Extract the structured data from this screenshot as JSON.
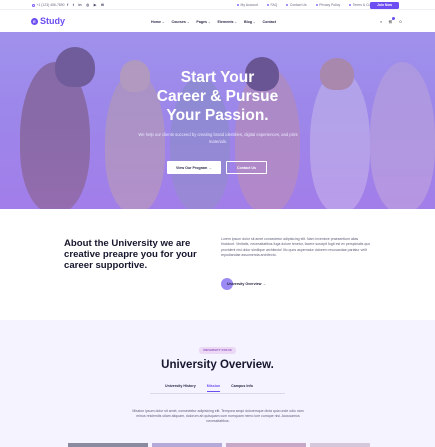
{
  "topbar": {
    "phone": "+1 (123) 456-7890",
    "socials": [
      "f",
      "t",
      "in",
      "◎",
      "▶",
      "✉"
    ],
    "links": [
      "My Account",
      "FAQ",
      "Contact Us",
      "Privacy Policy",
      "Terms & Condition"
    ],
    "join_label": "Join Now"
  },
  "header": {
    "logo_mark": "E",
    "logo_text": "Study",
    "nav": [
      {
        "label": "Home",
        "caret": true
      },
      {
        "label": "Courses",
        "caret": true
      },
      {
        "label": "Pages",
        "caret": true
      },
      {
        "label": "Elements",
        "caret": true
      },
      {
        "label": "Blog",
        "caret": true
      },
      {
        "label": "Contact",
        "caret": false
      }
    ],
    "cart_count": "0",
    "search_icon": "search-icon",
    "cart_icon": "cart-icon"
  },
  "hero": {
    "title_line1": "Start Your",
    "title_line2": "Career & Pursue",
    "title_line3": "Your Passion.",
    "subtitle": "We help our clients succeed by creating brand identities, digital experiences, and print materials.",
    "primary_btn": "View Our Program →",
    "secondary_btn": "Contact Us"
  },
  "about": {
    "heading": "About the University we are creative preapre you for your career supportive.",
    "body": "Lorem ipsum dolor sit amet consectetur adipisicing elit. Nam inventore praesentium alias tincidunt. Veritatis, necessitatibus fuga dolore tenetur, facere suscipit fugit est ex perspiciatis quo provident nisi dolor similique architecto! Illo quos aspernatur dolorem recusandae pariatur velit repudiandae assumenda architecto.",
    "link_label": "University Overview →"
  },
  "overview": {
    "badge": "UNIVERSITY FOCUS",
    "title": "University Overview.",
    "tabs": [
      {
        "label": "University History",
        "active": false
      },
      {
        "label": "Mission",
        "active": true
      },
      {
        "label": "Campus Info",
        "active": false
      }
    ],
    "description": "Mission ipsum dolor sit amet, consectetur adipisicing elit. Tempora sequi doloremque dicta quia unde odio nam minus reiciendis ullam aliquam, dolorum ab quisquam cum numquam nemo iure cumque nisi. Accusamus necessitatibus."
  },
  "colors": {
    "accent": "#6c4ef2",
    "hero_tint": "#a490e8",
    "section_bg": "#f4f3ff"
  }
}
